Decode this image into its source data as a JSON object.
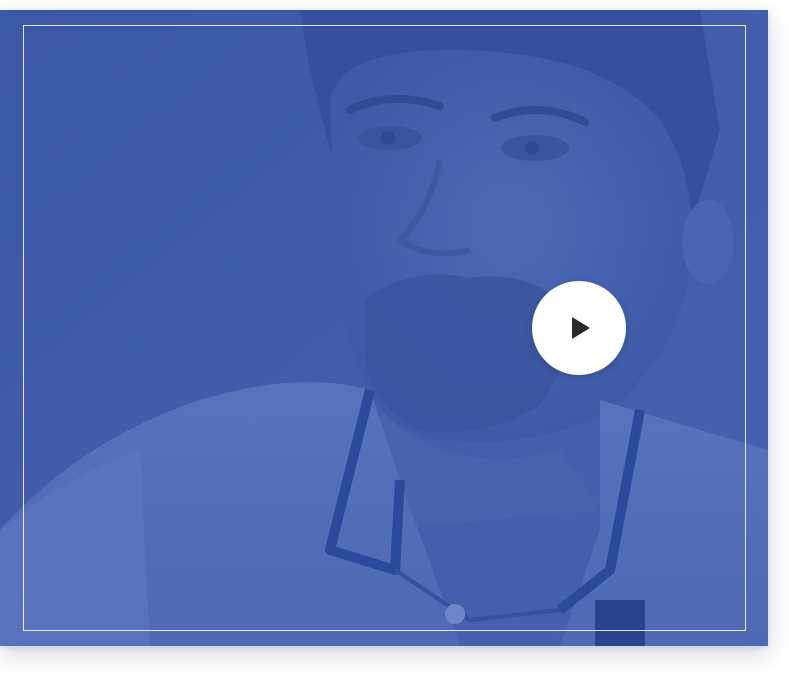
{
  "video": {
    "overlay_color": "#3d5aa8",
    "play_button": {
      "icon": "play-icon",
      "background": "#ffffff",
      "icon_color": "#2a2a2a"
    }
  }
}
